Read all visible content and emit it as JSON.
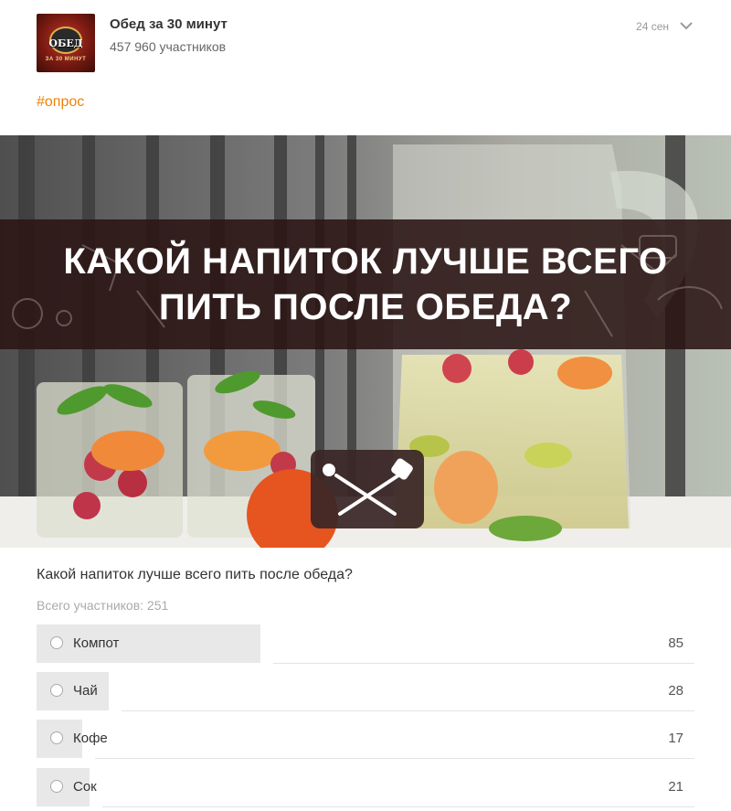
{
  "post": {
    "group_name": "Обед за 30 минут",
    "members": "457 960 участников",
    "date": "24 сен",
    "hashtag": "#опрос",
    "avatar_text": "ОБЕД",
    "avatar_sub": "ЗА 30 МИНУТ"
  },
  "banner": {
    "line1": "КАКОЙ НАПИТОК ЛУЧШЕ ВСЕГО",
    "line2": "ПИТЬ ПОСЛЕ ОБЕДА?"
  },
  "poll": {
    "question": "Какой напиток лучше всего пить после обеда?",
    "total": "Всего участников: 251",
    "options": [
      {
        "label": "Компот",
        "count": "85",
        "share": 0.34
      },
      {
        "label": "Чай",
        "count": "28",
        "share": 0.11
      },
      {
        "label": "Кофе",
        "count": "17",
        "share": 0.07
      },
      {
        "label": "Сок",
        "count": "21",
        "share": 0.08
      }
    ]
  },
  "colors": {
    "accent": "#ee8208",
    "bar": "#e8e8e8",
    "banner_strip": "#2a1413"
  }
}
